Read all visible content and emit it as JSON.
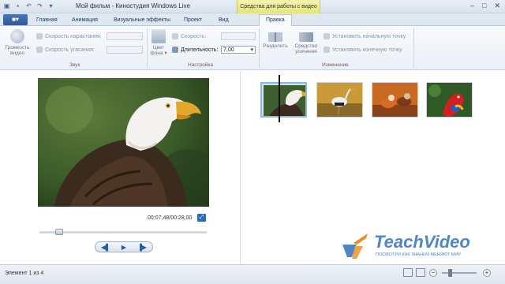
{
  "window": {
    "title": "Мой фильм - Киностудия Windows Live",
    "contextual_header": "Средства для работы с видео"
  },
  "tabs": {
    "file_label": "■▾",
    "items": [
      "Главная",
      "Анимация",
      "Визуальные эффекты",
      "Проект",
      "Вид",
      "Правка"
    ],
    "active": "Правка"
  },
  "ribbon": {
    "audio_group": {
      "label": "Звук",
      "volume_label_1": "Громкость",
      "volume_label_2": "видео",
      "fade_in_label": "Скорость нарастания:",
      "fade_out_label": "Скорость угасания:"
    },
    "adjust_group": {
      "label": "Настройка",
      "bg_color_label_1": "Цвет",
      "bg_color_label_2": "фона ▾",
      "speed_label": "Скорость:",
      "duration_label": "Длительность:",
      "duration_value": "7,00"
    },
    "edit_group": {
      "label": "Изменение",
      "split_label": "Разделить",
      "trim_label_1": "Средство",
      "trim_label_2": "усечения",
      "set_start_label": "Установить начальную точку",
      "set_end_label": "Установить конечную точку"
    }
  },
  "preview": {
    "timecode": "00:07,48/00:28,00",
    "seek_fraction": 0.1
  },
  "status": {
    "text": "Элемент 1 из 4"
  },
  "watermark": {
    "title": "TeachVideo",
    "subtitle": "ПОСМОТРИ КАК ЗНАНИЯ МЕНЯЮТ МИР"
  },
  "colors": {
    "accent": "#2b6cb0",
    "contextual": "#e6e47a",
    "watermark": "#4f86c6"
  }
}
